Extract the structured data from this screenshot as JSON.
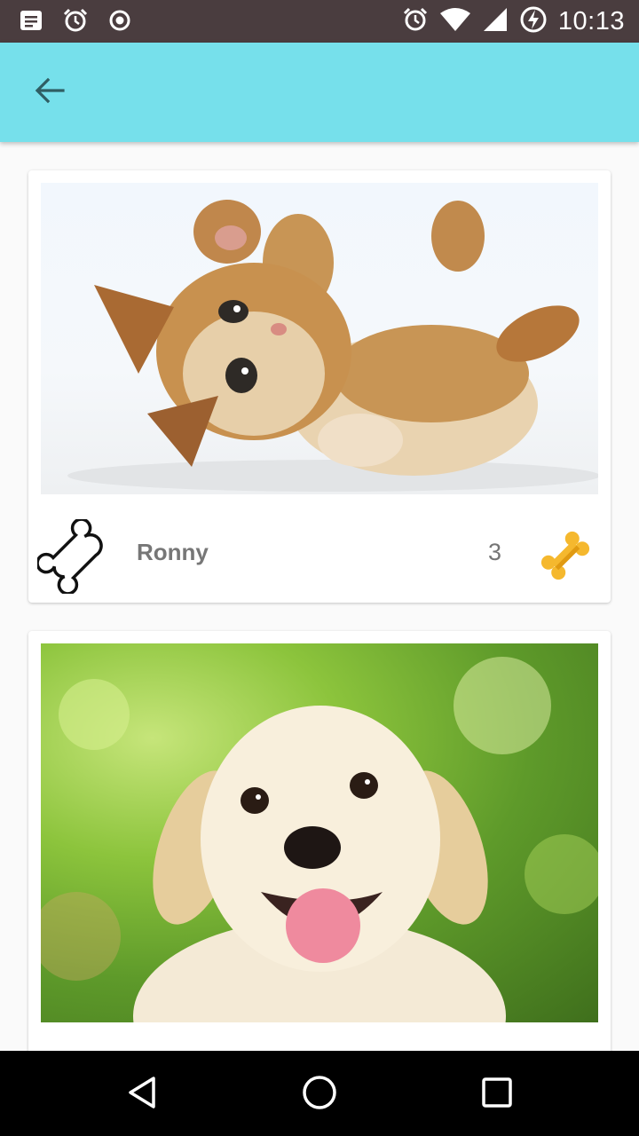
{
  "status_bar": {
    "time": "10:13",
    "left_icons": [
      "notification-message-icon",
      "alarm-icon",
      "record-icon"
    ],
    "right_icons": [
      "alarm-icon",
      "wifi-icon",
      "cell-signal-icon",
      "battery-charging-icon"
    ]
  },
  "app_bar": {
    "back_icon": "arrow-back-icon",
    "color": "#76e0eb"
  },
  "pets": [
    {
      "name": "Ronny",
      "likes": "3",
      "photo": "kitten-photo"
    },
    {
      "name": "",
      "likes": "",
      "photo": "puppy-photo"
    }
  ],
  "nav_bar": {
    "buttons": [
      "back-triangle-icon",
      "home-circle-icon",
      "recents-square-icon"
    ]
  },
  "colors": {
    "status_bar": "#4a3d3f",
    "accent_bone": "#f5b82e"
  }
}
